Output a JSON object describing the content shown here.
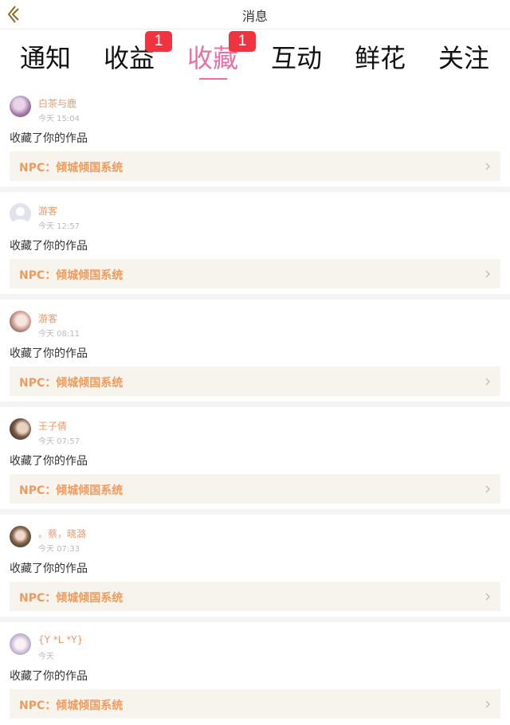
{
  "header": {
    "title": "消息",
    "back_icon": "chevron-left-icon"
  },
  "tabs": [
    {
      "label": "通知",
      "badge": ""
    },
    {
      "label": "收益",
      "badge": "1"
    },
    {
      "label": "收藏",
      "badge": "1",
      "active": true
    },
    {
      "label": "互动",
      "badge": ""
    },
    {
      "label": "鲜花",
      "badge": ""
    },
    {
      "label": "关注",
      "badge": ""
    }
  ],
  "colors": {
    "accent": "#e870a6",
    "badge": "#f0343f",
    "username": "#e89a6a",
    "work_title": "#f09a5e",
    "work_bg": "#f6f4ec"
  },
  "items": [
    {
      "user": "白茶与鹿",
      "time": "今天 15:04",
      "action": "收藏了你的作品",
      "work": "NPC：倾城倾国系统"
    },
    {
      "user": "游客",
      "time": "今天 12:57",
      "action": "收藏了你的作品",
      "work": "NPC：倾城倾国系统"
    },
    {
      "user": "游客",
      "time": "今天 08:11",
      "action": "收藏了你的作品",
      "work": "NPC：倾城倾国系统"
    },
    {
      "user": "王子倩",
      "time": "今天 07:57",
      "action": "收藏了你的作品",
      "work": "NPC：倾城倾国系统"
    },
    {
      "user": "。蔡，晓潞",
      "time": "今天 07:33",
      "action": "收藏了你的作品",
      "work": "NPC：倾城倾国系统"
    },
    {
      "user": "{Y *L *Y}",
      "time": "今天",
      "action": "收藏了你的作品",
      "work": "NPC：倾城倾国系统"
    }
  ]
}
